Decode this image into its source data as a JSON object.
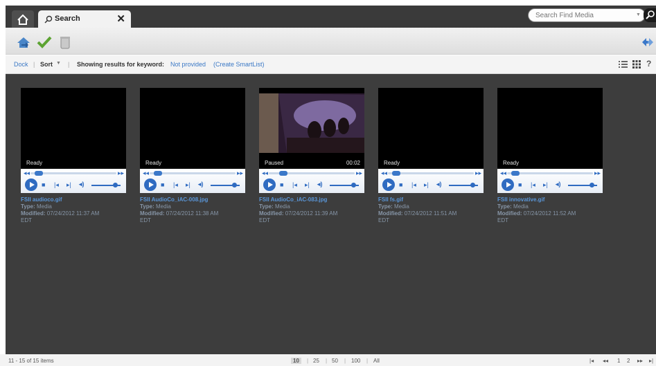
{
  "tabs": {
    "home_icon": "home-icon",
    "search_label": "Search",
    "close_label": "✕"
  },
  "find": {
    "placeholder": "Search Find Media"
  },
  "filter": {
    "dock": "Dock",
    "sort": "Sort",
    "showing_label": "Showing results for keyword:",
    "keyword": "Not provided",
    "create": "(Create SmartList)"
  },
  "cards": [
    {
      "name": "FSII audioco.gif",
      "type": "Media",
      "modified": "07/24/2012 11:37 AM",
      "tz": "EDT",
      "status": "Ready",
      "time": "",
      "progress": 0.05
    },
    {
      "name": "FSII AudioCo_iAC-008.jpg",
      "type": "Media",
      "modified": "07/24/2012 11:38 AM",
      "tz": "EDT",
      "status": "Ready",
      "time": "",
      "progress": 0.05
    },
    {
      "name": "FSII AudioCo_iAC-083.jpg",
      "type": "Media",
      "modified": "07/24/2012 11:39 AM",
      "tz": "EDT",
      "status": "Paused",
      "time": "00:02",
      "progress": 0.12
    },
    {
      "name": "FSII fs.gif",
      "type": "Media",
      "modified": "07/24/2012 11:51 AM",
      "tz": "EDT",
      "status": "Ready",
      "time": "",
      "progress": 0.05
    },
    {
      "name": "FSII innovative.gif",
      "type": "Media",
      "modified": "07/24/2012 11:52 AM",
      "tz": "EDT",
      "status": "Ready",
      "time": "",
      "progress": 0.05
    }
  ],
  "labels": {
    "type": "Type:",
    "modified": "Modified:"
  },
  "pager": {
    "range": "11 - 15 of 15 items",
    "sizes": [
      "10",
      "25",
      "50",
      "100",
      "All"
    ],
    "pages": [
      "1",
      "2"
    ]
  },
  "colors": {
    "accent": "#3a78c5",
    "content_bg": "#3d3d3d"
  }
}
